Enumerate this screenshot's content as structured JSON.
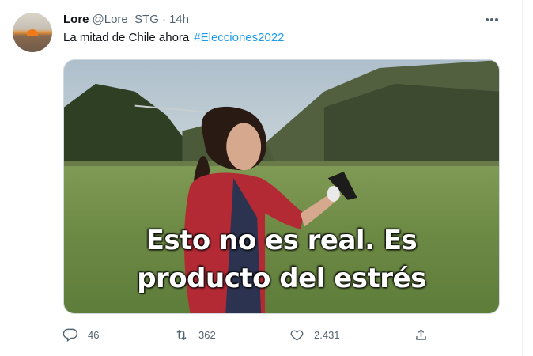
{
  "tweet": {
    "author_name": "Lore",
    "author_handle": "@Lore_STG",
    "separator": "·",
    "time": "14h",
    "text": "La mitad de Chile ahora",
    "hashtag": "#Elecciones2022",
    "media": {
      "caption_line1": "Esto no es real. Es",
      "caption_line2": "producto del estrés"
    },
    "actions": {
      "replies": "46",
      "retweets": "362",
      "likes": "2.431"
    }
  },
  "icons": {
    "more": "more-horizontal-icon",
    "reply": "reply-icon",
    "retweet": "retweet-icon",
    "like": "heart-icon",
    "share": "share-icon"
  },
  "colors": {
    "link": "#1d9bf0",
    "secondary_text": "#536471",
    "primary_text": "#0f1419"
  }
}
